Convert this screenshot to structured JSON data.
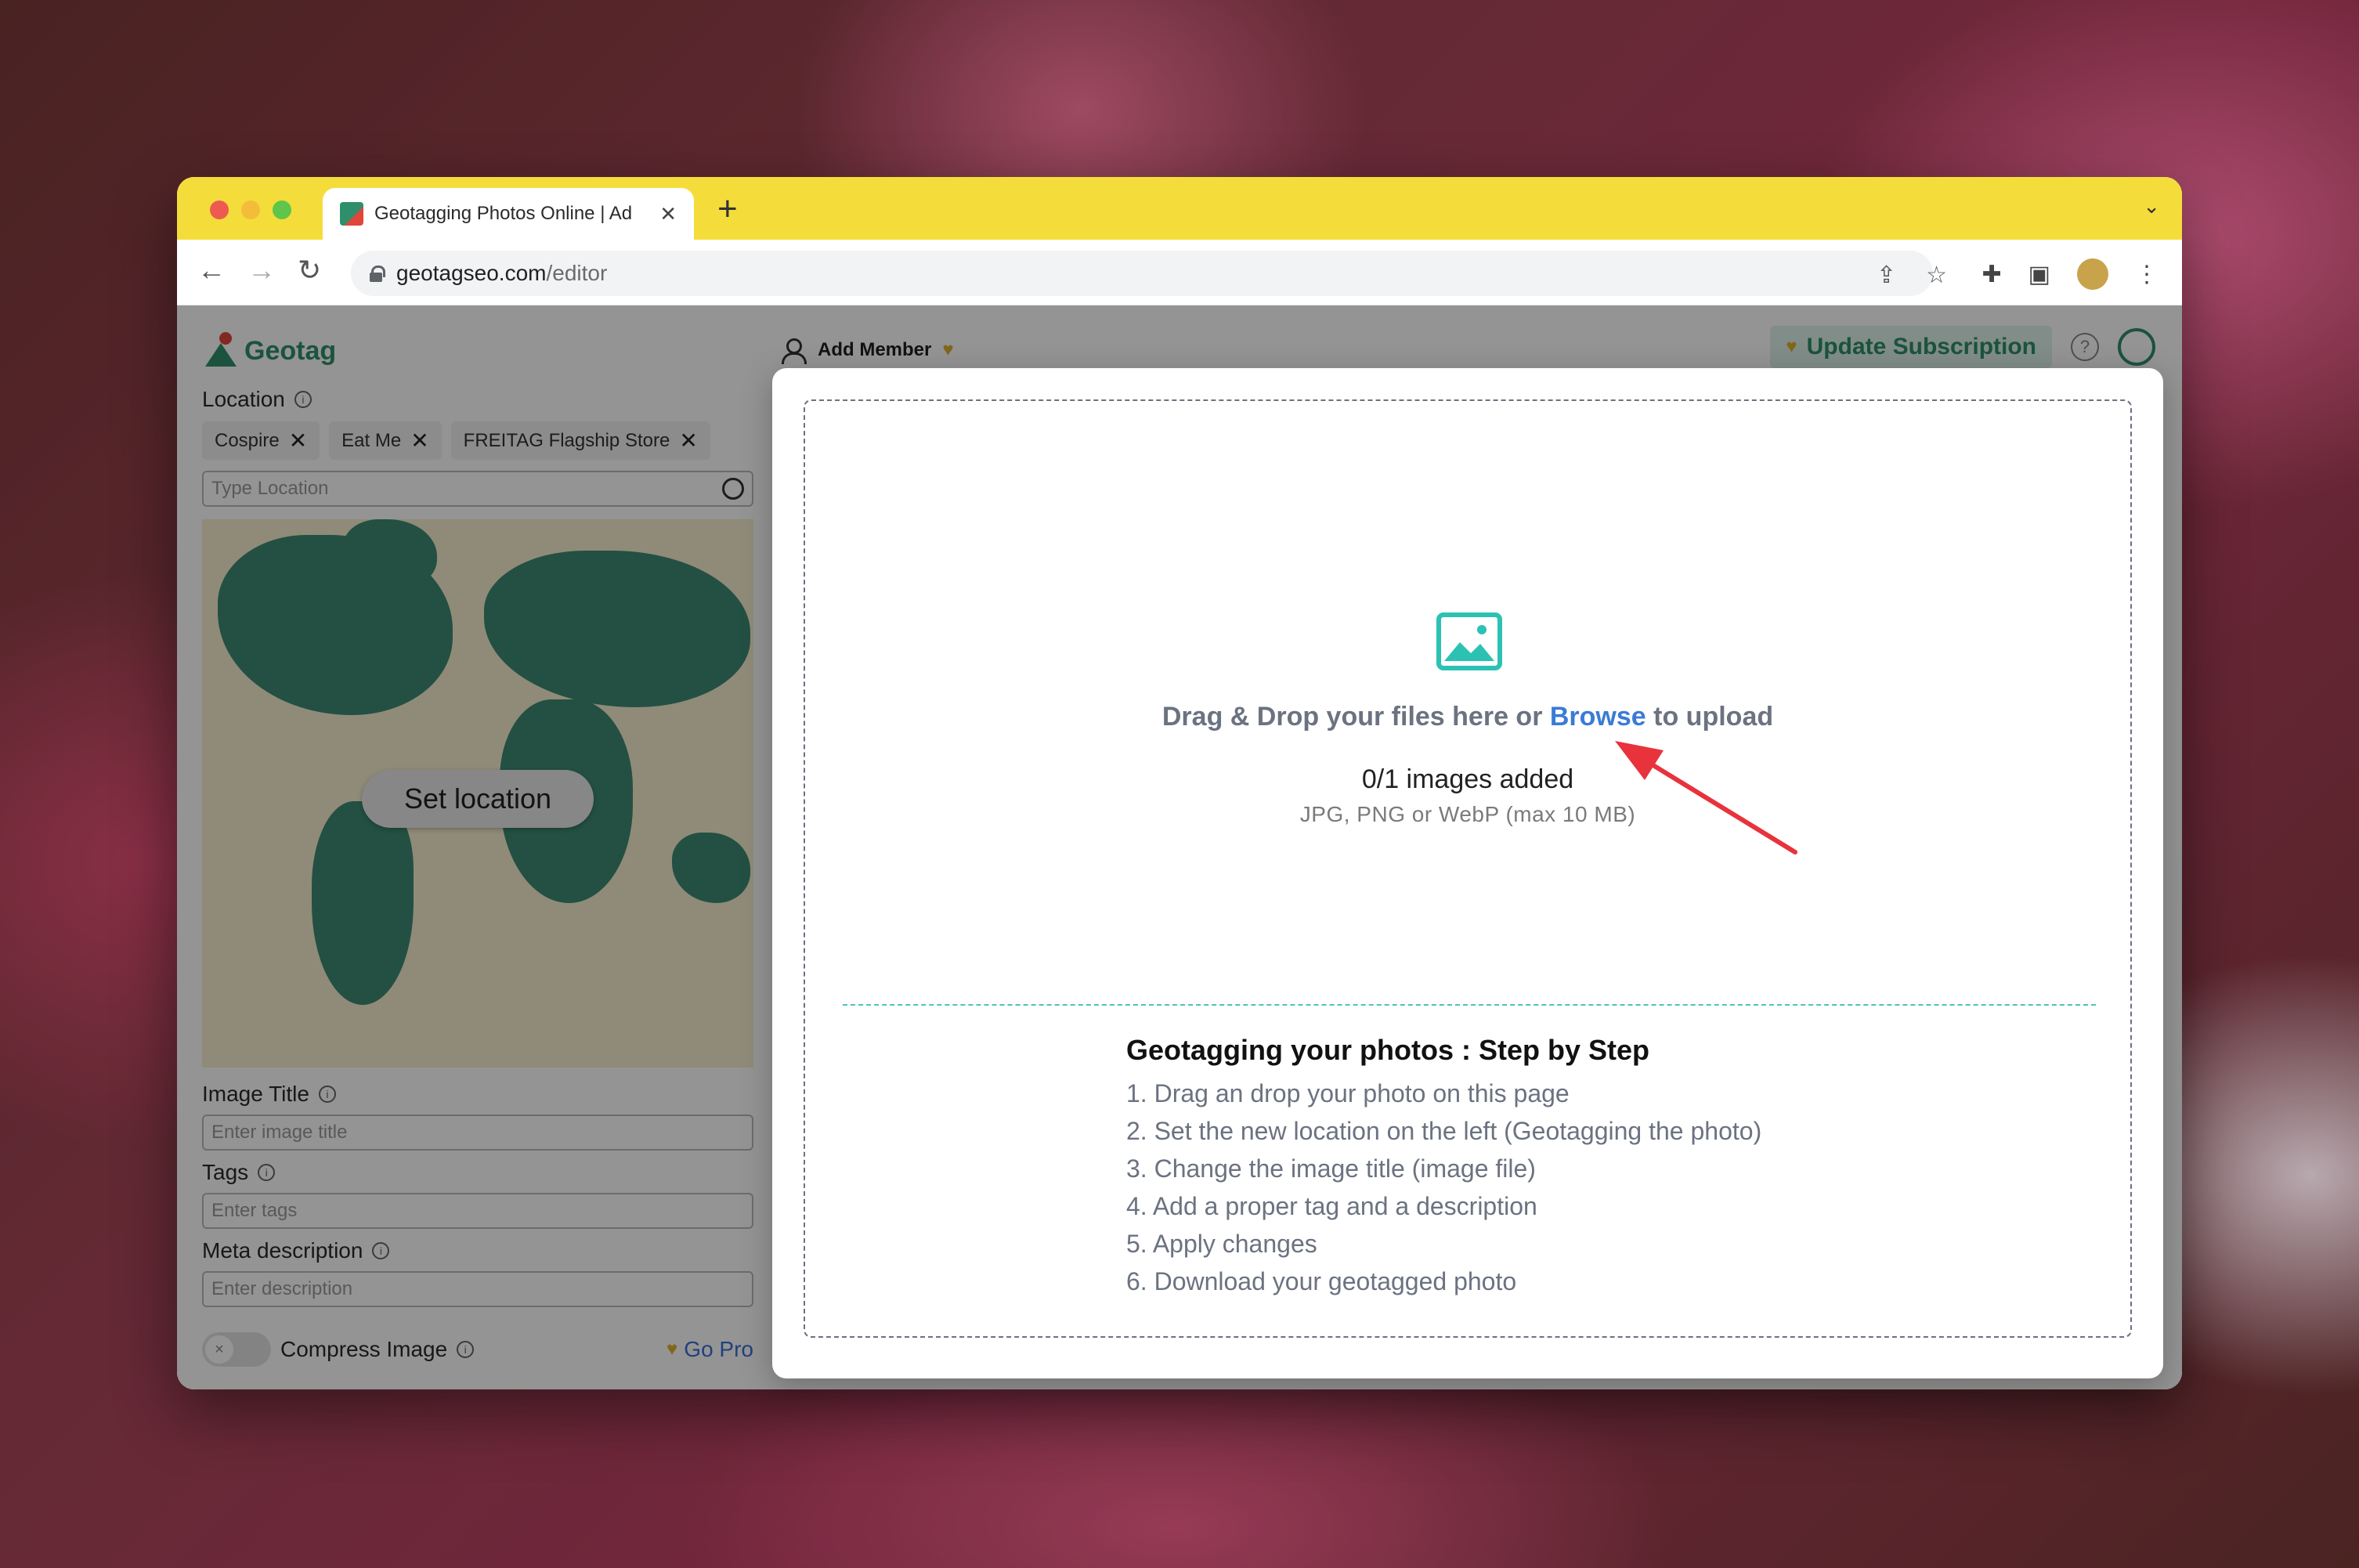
{
  "browser": {
    "tab_title": "Geotagging Photos Online | Ad",
    "url_host": "geotagseo.com",
    "url_path": "/editor"
  },
  "app": {
    "logo_text": "Geotag",
    "add_member": "Add Member",
    "update_subscription": "Update Subscription",
    "help": "?"
  },
  "sidebar": {
    "location_label": "Location",
    "chips": [
      "Cospire",
      "Eat Me",
      "FREITAG Flagship Store"
    ],
    "location_placeholder": "Type Location",
    "set_location": "Set location",
    "image_title_label": "Image Title",
    "image_title_placeholder": "Enter image title",
    "tags_label": "Tags",
    "tags_placeholder": "Enter tags",
    "meta_label": "Meta description",
    "meta_placeholder": "Enter description",
    "compress_label": "Compress Image",
    "go_pro": "Go Pro"
  },
  "modal": {
    "drop_prefix": "Drag & Drop your files here or ",
    "browse": "Browse",
    "drop_suffix": " to upload",
    "count": "0/1 images added",
    "formats": "JPG, PNG or WebP (max 10 MB)",
    "steps_title": "Geotagging your photos : Step by Step",
    "steps": [
      "1. Drag an drop your photo on this page",
      "2. Set the new location on the left (Geotagging the photo)",
      "3. Change the image title (image file)",
      "4. Add a proper tag and a description",
      "5. Apply changes",
      "6. Download your geotagged photo"
    ]
  },
  "colors": {
    "accent": "#2f8f6b",
    "browse": "#3a7bd5",
    "teal_icon": "#2cc2b3",
    "annotation_arrow": "#e8323c"
  }
}
